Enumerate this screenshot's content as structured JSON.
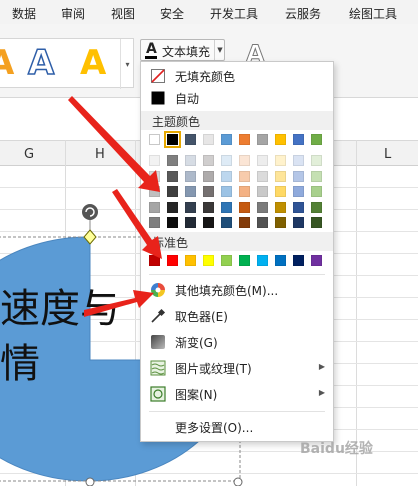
{
  "ribbon": {
    "tabs": [
      "数据",
      "审阅",
      "视图",
      "安全",
      "开发工具",
      "云服务",
      "绘图工具"
    ],
    "gallery_letters": [
      "A",
      "A",
      "A"
    ],
    "fill_button_glyph": "A",
    "fill_button_label": "文本填充",
    "effect_glyph": "A"
  },
  "sheet": {
    "columns": [
      "G",
      "H",
      "L"
    ]
  },
  "shape": {
    "text_lines": [
      "速度与",
      "情"
    ],
    "fill_color": "#5b9bd5"
  },
  "fill_menu": {
    "no_fill_label": "无填充颜色",
    "auto_label": "自动",
    "theme_colors_header": "主题颜色",
    "standard_colors_header": "标准色",
    "more_colors_label": "其他填充颜色(M)...",
    "eyedropper_label": "取色器(E)",
    "gradient_label": "渐变(G)",
    "picture_texture_label": "图片或纹理(T)",
    "pattern_label": "图案(N)",
    "more_settings_label": "更多设置(O)...",
    "theme_top_row": [
      "#ffffff",
      "#000000",
      "#44546a",
      "#e7e6e6",
      "#5b9bd5",
      "#ed7d31",
      "#a5a5a5",
      "#ffc000",
      "#4472c4",
      "#70ad47"
    ],
    "theme_shades": [
      [
        "#f2f2f2",
        "#7f7f7f",
        "#d6dce4",
        "#d0cece",
        "#deebf6",
        "#fbe5d5",
        "#ededed",
        "#fff2cc",
        "#dae3f3",
        "#e2efd9"
      ],
      [
        "#d8d8d8",
        "#595959",
        "#adb9ca",
        "#aeabab",
        "#bdd7ee",
        "#f7cbac",
        "#dbdbdb",
        "#fee599",
        "#b4c6e7",
        "#c5e0b3"
      ],
      [
        "#bfbfbf",
        "#3f3f3f",
        "#8497b0",
        "#757070",
        "#9cc3e5",
        "#f4b183",
        "#c9c9c9",
        "#ffd965",
        "#8faadc",
        "#a8d08d"
      ],
      [
        "#a5a5a5",
        "#262626",
        "#333f4f",
        "#3a3838",
        "#2e75b5",
        "#c55a11",
        "#7b7b7b",
        "#bf8f00",
        "#2f5496",
        "#538135"
      ],
      [
        "#7f7f7f",
        "#0c0c0c",
        "#222a35",
        "#171616",
        "#1f4e79",
        "#833c0b",
        "#525252",
        "#7f6000",
        "#1f3864",
        "#375623"
      ]
    ],
    "standard_colors": [
      "#c00000",
      "#ff0000",
      "#ffc000",
      "#ffff00",
      "#92d050",
      "#00b050",
      "#00b0f0",
      "#0070c0",
      "#002060",
      "#7030a0"
    ]
  },
  "watermark": "Baidu经验",
  "colors": {
    "arrow_red": "#e8231b",
    "selection_handle": "#ffff99"
  }
}
